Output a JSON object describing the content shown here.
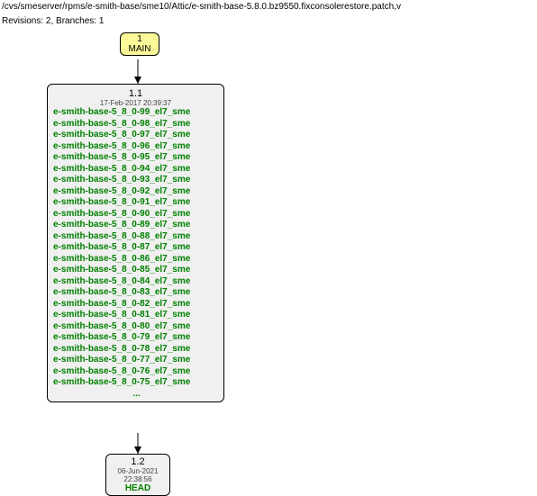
{
  "header": {
    "path": "/cvs/smeserver/rpms/e-smith-base/sme10/Attic/e-smith-base-5.8.0.bz9550.fixconsolerestore.patch,v",
    "revline": "Revisions: 2, Branches: 1"
  },
  "node_top": {
    "rev": "1",
    "label": "MAIN"
  },
  "node_mid": {
    "rev": "1.1",
    "date": "17-Feb-2017 20:39:37",
    "tags": [
      "e-smith-base-5_8_0-99_el7_sme",
      "e-smith-base-5_8_0-98_el7_sme",
      "e-smith-base-5_8_0-97_el7_sme",
      "e-smith-base-5_8_0-96_el7_sme",
      "e-smith-base-5_8_0-95_el7_sme",
      "e-smith-base-5_8_0-94_el7_sme",
      "e-smith-base-5_8_0-93_el7_sme",
      "e-smith-base-5_8_0-92_el7_sme",
      "e-smith-base-5_8_0-91_el7_sme",
      "e-smith-base-5_8_0-90_el7_sme",
      "e-smith-base-5_8_0-89_el7_sme",
      "e-smith-base-5_8_0-88_el7_sme",
      "e-smith-base-5_8_0-87_el7_sme",
      "e-smith-base-5_8_0-86_el7_sme",
      "e-smith-base-5_8_0-85_el7_sme",
      "e-smith-base-5_8_0-84_el7_sme",
      "e-smith-base-5_8_0-83_el7_sme",
      "e-smith-base-5_8_0-82_el7_sme",
      "e-smith-base-5_8_0-81_el7_sme",
      "e-smith-base-5_8_0-80_el7_sme",
      "e-smith-base-5_8_0-79_el7_sme",
      "e-smith-base-5_8_0-78_el7_sme",
      "e-smith-base-5_8_0-77_el7_sme",
      "e-smith-base-5_8_0-76_el7_sme",
      "e-smith-base-5_8_0-75_el7_sme"
    ],
    "ellipsis": "..."
  },
  "node_bot": {
    "rev": "1.2",
    "date": "06-Jun-2021 22:38:56",
    "head": "HEAD"
  },
  "chart_data": {
    "type": "diagram",
    "title": "CVS revision tree",
    "nodes": [
      {
        "id": "MAIN",
        "rev": "1",
        "label": "MAIN",
        "type": "branch"
      },
      {
        "id": "1.1",
        "rev": "1.1",
        "date": "17-Feb-2017 20:39:37",
        "tag_count": 25,
        "tags_truncated": true
      },
      {
        "id": "1.2",
        "rev": "1.2",
        "date": "06-Jun-2021 22:38:56",
        "label": "HEAD"
      }
    ],
    "edges": [
      {
        "from": "MAIN",
        "to": "1.1"
      },
      {
        "from": "1.1",
        "to": "1.2"
      }
    ]
  }
}
